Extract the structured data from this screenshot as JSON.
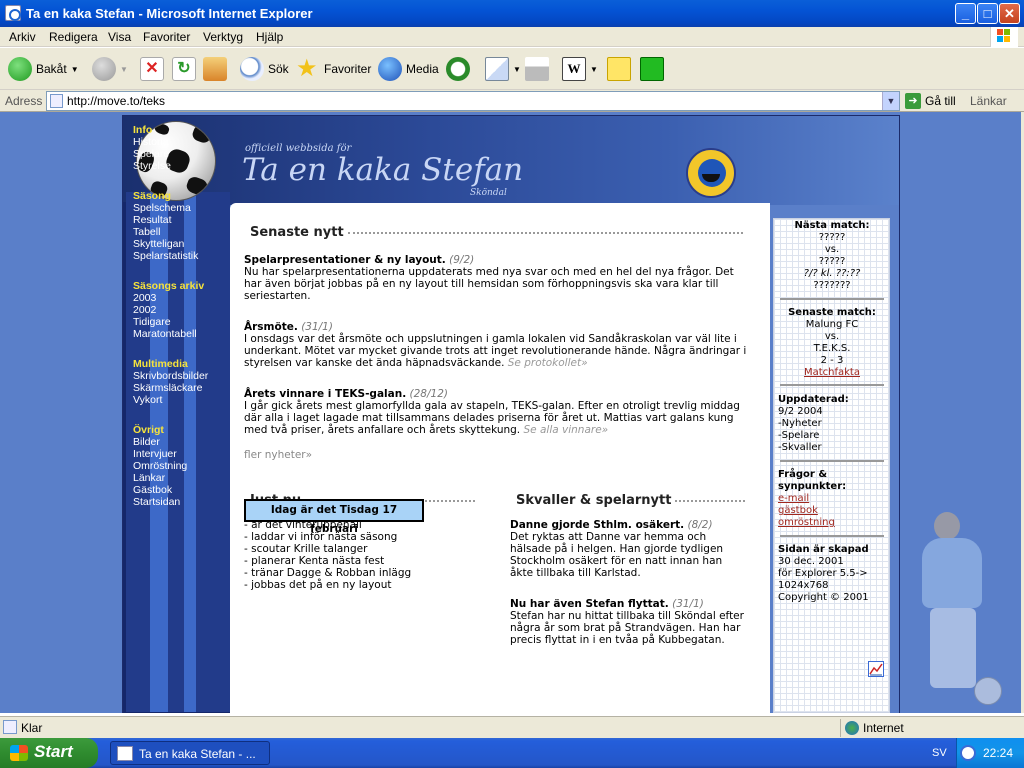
{
  "window": {
    "title": "Ta en kaka Stefan - Microsoft Internet Explorer",
    "min": "_",
    "max": "□",
    "close": "✕"
  },
  "menu": [
    "Arkiv",
    "Redigera",
    "Visa",
    "Favoriter",
    "Verktyg",
    "Hjälp"
  ],
  "toolbar": {
    "back": "Bakåt",
    "search": "Sök",
    "favorites": "Favoriter",
    "media": "Media"
  },
  "address": {
    "label": "Adress",
    "url": "http://move.to/teks",
    "go": "Gå till",
    "links": "Länkar"
  },
  "site": {
    "subtitle": "officiell webbsida för",
    "title": "Ta en kaka Stefan",
    "place": "Sköndal"
  },
  "nav": [
    {
      "head": "Info",
      "items": [
        "Historia",
        "Spelare",
        "Styrelse"
      ]
    },
    {
      "head": "Säsong",
      "items": [
        "Spelschema",
        "Resultat",
        "Tabell",
        "Skytteligan",
        "Spelarstatistik"
      ]
    },
    {
      "head": "Säsongs arkiv",
      "items": [
        "2003",
        "2002",
        "Tidigare",
        "Maratontabell"
      ]
    },
    {
      "head": "Multimedia",
      "items": [
        "Skrivbordsbilder",
        "Skärmsläckare",
        "Vykort"
      ]
    },
    {
      "head": "Övrigt",
      "items": [
        "Bilder",
        "Intervjuer",
        "Omröstning",
        "Länkar",
        "Gästbok",
        "Startsidan"
      ]
    }
  ],
  "news": {
    "heading": "Senaste nytt",
    "articles": [
      {
        "title": "Spelarpresentationer & ny layout.",
        "date": "(9/2)",
        "body": "Nu har spelarpresentationerna uppdaterats med nya svar och med en hel del nya frågor. Det har även börjat jobbas på en ny layout till hemsidan som förhoppningsvis ska vara klar till seriestarten.",
        "more": ""
      },
      {
        "title": "Årsmöte.",
        "date": "(31/1)",
        "body": "I onsdags var det årsmöte och uppslutningen i gamla lokalen vid Sandåkraskolan var väl lite i underkant. Mötet var mycket givande trots att inget revolutionerande hände. Några ändringar i styrelsen var kanske det ända häpnadsväckande.",
        "more": "Se protokollet»"
      },
      {
        "title": "Årets vinnare i TEKS-galan.",
        "date": "(28/12)",
        "body": "I går gick årets mest glamorfyllda gala av stapeln, TEKS-galan. Efter en otroligt trevlig middag där alla i laget lagade mat tillsammans delades priserna för året ut. Mattias vart galans kung med två priser, årets anfallare och årets skyttekung.",
        "more": "Se alla vinnare»"
      }
    ],
    "more_news": "fler nyheter»"
  },
  "justnu": {
    "heading": "Just nu",
    "items": [
      "- är det vinteruppehåll",
      "- laddar vi inför nästa säsong",
      "- scoutar Krille talanger",
      "- planerar Kenta nästa fest",
      "- tränar Dagge & Robban inlägg",
      "- jobbas det på en ny layout"
    ],
    "today": "Idag är det Tisdag 17 februari"
  },
  "skvaller": {
    "heading": "Skvaller & spelarnytt",
    "articles": [
      {
        "title": "Danne gjorde Sthlm. osäkert.",
        "date": "(8/2)",
        "body": "Det ryktas att Danne var hemma och hälsade på i helgen. Han gjorde tydligen Stockholm osäkert för en natt innan han åkte tillbaka till Karlstad."
      },
      {
        "title": "Nu har även Stefan flyttat.",
        "date": "(31/1)",
        "body": "Stefan har nu hittat tillbaka till Sköndal efter några år som brat på Strandvägen. Han har precis flyttat in i en tvåa på Kubbegatan."
      }
    ]
  },
  "sidebar": {
    "next_match": {
      "head": "Nästa match:",
      "team1": "?????",
      "vs": "vs.",
      "team2": "?????",
      "when": "?/? kl. ??:??",
      "where": "???????"
    },
    "last_match": {
      "head": "Senaste match:",
      "team1": "Malung FC",
      "vs": "vs.",
      "team2": "T.E.K.S.",
      "score": "2 - 3",
      "link": "Matchfakta"
    },
    "updated": {
      "head": "Uppdaterad:",
      "date": "9/2 2004",
      "items": [
        "-Nyheter",
        "-Spelare",
        "-Skvaller"
      ]
    },
    "contact": {
      "head": "Frågor & synpunkter:",
      "links": [
        "e-mail",
        "gästbok",
        "omröstning"
      ]
    },
    "made": {
      "head": "Sidan är skapad",
      "lines": [
        "30 dec. 2001",
        "för Explorer 5.5->",
        "1024x768",
        "Copyright © 2001"
      ]
    }
  },
  "status": {
    "text": "Klar",
    "zone": "Internet"
  },
  "taskbar": {
    "start": "Start",
    "task": "Ta en kaka Stefan - ...",
    "lang": "SV",
    "time": "22:24"
  }
}
